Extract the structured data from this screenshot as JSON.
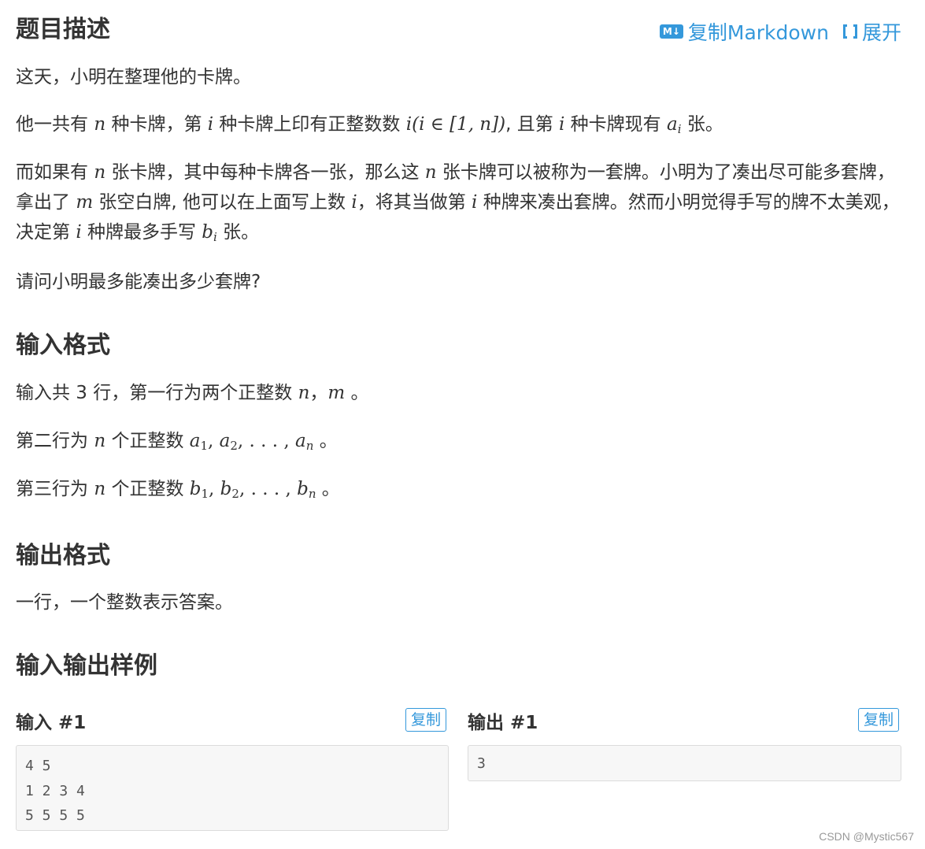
{
  "description": {
    "title": "题目描述",
    "p1": "这天，小明在整理他的卡牌。",
    "p2": {
      "t1": "他一共有 ",
      "n": "n",
      "t2": " 种卡牌，第 ",
      "i": "i",
      "t3": " 种卡牌上印有正整数数 ",
      "expr": "i(i ∈ [1, n])",
      "t4": ", 且第 ",
      "t5": " 种卡牌现有 ",
      "a": "a",
      "ai_sub": "i",
      "t6": " 张。"
    },
    "p3": {
      "t1": "而如果有 ",
      "t2": " 张卡牌，其中每种卡牌各一张，那么这 ",
      "t3": " 张卡牌可以被称为一套牌。小明为了凑出尽可能多套牌，拿出了 ",
      "m": "m",
      "t4": " 张空白牌, 他可以在上面写上数 ",
      "t5": "，将其当做第 ",
      "t6": " 种牌来凑出套牌。然而小明觉得手写的牌不太美观，决定第 ",
      "t7": " 种牌最多手写 ",
      "b": "b",
      "t8": " 张。"
    },
    "p4": "请问小明最多能凑出多少套牌?"
  },
  "toolbar": {
    "copy_markdown": "复制Markdown",
    "md_badge": "M↓",
    "expand": "展开"
  },
  "input_format": {
    "title": "输入格式",
    "l1_text": "输入共 3 行，第一行为两个正整数 ",
    "l1_sep": "，",
    "l1_end": " 。",
    "l2_text": "第二行为 ",
    "l2_mid": " 个正整数 ",
    "l3_text": "第三行为 ",
    "l3_mid": " 个正整数 ",
    "dots": ", . . . , ",
    "comma": ", ",
    "sub1": "1",
    "sub2": "2",
    "end": " 。"
  },
  "output_format": {
    "title": "输出格式",
    "text": "一行，一个整数表示答案。"
  },
  "samples": {
    "title": "输入输出样例",
    "input_label": "输入 #1",
    "output_label": "输出 #1",
    "copy": "复制",
    "input_text": "4 5\n1 2 3 4\n5 5 5 5",
    "output_text": "3"
  },
  "watermark": "CSDN @Mystic567"
}
